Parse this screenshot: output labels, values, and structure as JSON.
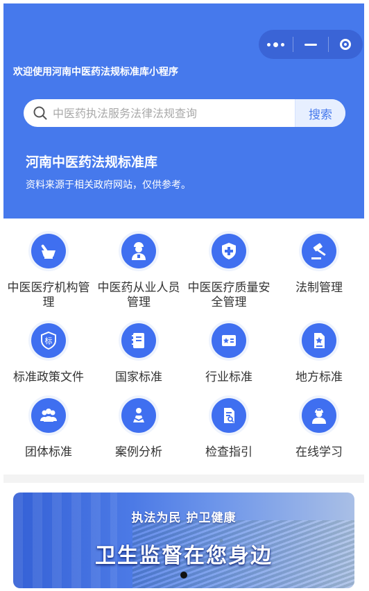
{
  "header": {
    "welcome": "欢迎使用河南中医药法规标准库小程序",
    "title": "河南中医药法规标准库",
    "subtitle": "资料来源于相关政府网站，仅供参考。",
    "bg_color": "#4679ec"
  },
  "capsule": {
    "icons": [
      "more-dots-icon",
      "minimize-icon",
      "close-target-icon"
    ]
  },
  "search": {
    "placeholder": "中医药执法服务法律法规查询",
    "button_label": "搜索"
  },
  "menu": [
    {
      "label": "中医医疗机构管理",
      "icon": "mortar-pestle-icon"
    },
    {
      "label": "中医药从业人员管理",
      "icon": "doctor-icon"
    },
    {
      "label": "中医医疗质量安全管理",
      "icon": "shield-cross-icon"
    },
    {
      "label": "法制管理",
      "icon": "gavel-icon"
    },
    {
      "label": "标准政策文件",
      "icon": "standard-badge-icon"
    },
    {
      "label": "国家标准",
      "icon": "notebook-icon"
    },
    {
      "label": "行业标准",
      "icon": "star-card-icon"
    },
    {
      "label": "地方标准",
      "icon": "star-document-icon"
    },
    {
      "label": "团体标准",
      "icon": "group-icon"
    },
    {
      "label": "案例分析",
      "icon": "reading-person-icon"
    },
    {
      "label": "检查指引",
      "icon": "inspect-document-icon"
    },
    {
      "label": "在线学习",
      "icon": "student-icon"
    }
  ],
  "banner": {
    "line1": "执法为民  护卫健康",
    "line2": "卫生监督在您身边",
    "page_count": 1,
    "current_page": 1
  }
}
